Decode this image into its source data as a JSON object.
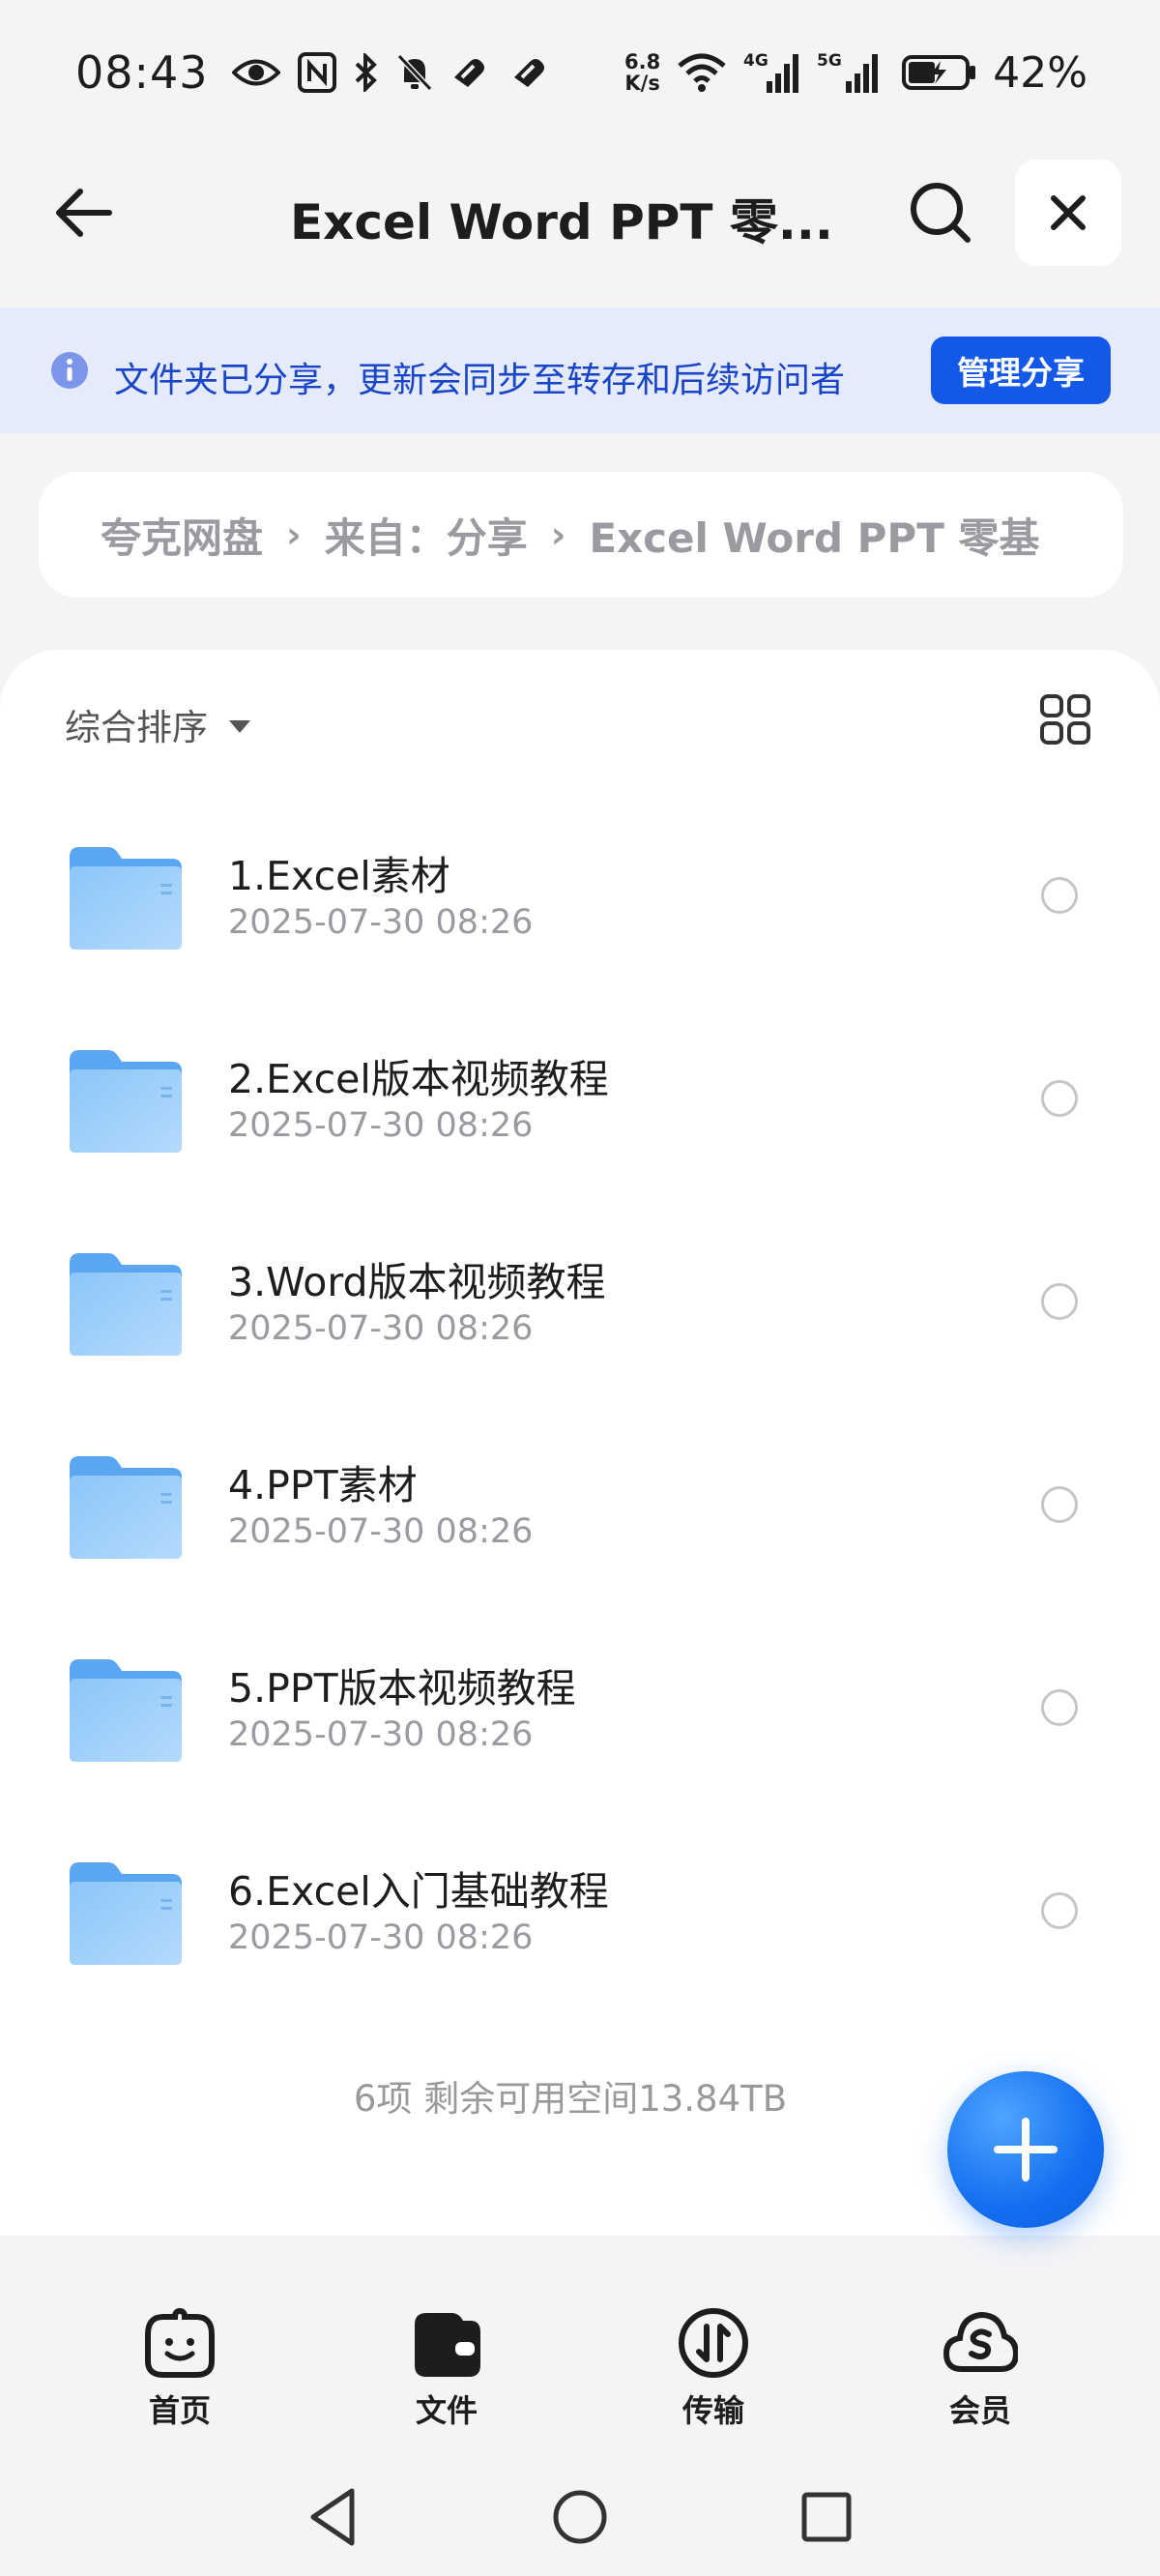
{
  "status_bar": {
    "time": "08:43",
    "net_rate_value": "6.8",
    "net_rate_unit": "K/s",
    "battery_percent": "42%",
    "left_icons": [
      "eye-icon",
      "nfc-icon",
      "bluetooth-icon",
      "mute-icon",
      "heart-icon",
      "heart-icon"
    ],
    "right_icons": [
      "wifi-icon",
      "signal-4g-icon",
      "signal-5g-icon",
      "battery-charging-icon"
    ]
  },
  "header": {
    "title": "Excel Word PPT 零...",
    "back_icon": "back-arrow-icon",
    "search_icon": "search-icon",
    "close_icon": "close-icon"
  },
  "banner": {
    "text": "文件夹已分享，更新会同步至转存和后续访问者",
    "button_label": "管理分享",
    "icon": "info-icon",
    "color": "#1946c8",
    "button_color": "#1358e6"
  },
  "breadcrumb": {
    "items": [
      "夸克网盘",
      "来自：分享",
      "Excel Word PPT 零基"
    ],
    "separator": "›"
  },
  "toolbar": {
    "sort_label": "综合排序",
    "view_icon": "grid-view-icon"
  },
  "files": [
    {
      "name": "1.Excel素材",
      "date": "2025-07-30 08:26"
    },
    {
      "name": "2.Excel版本视频教程",
      "date": "2025-07-30 08:26"
    },
    {
      "name": "3.Word版本视频教程",
      "date": "2025-07-30 08:26"
    },
    {
      "name": "4.PPT素材",
      "date": "2025-07-30 08:26"
    },
    {
      "name": "5.PPT版本视频教程",
      "date": "2025-07-30 08:26"
    },
    {
      "name": "6.Excel入门基础教程",
      "date": "2025-07-30 08:26"
    }
  ],
  "summary": "6项 剩余可用空间13.84TB",
  "fab_icon": "plus-icon",
  "tabs": [
    {
      "label": "首页",
      "icon": "home-smile-icon"
    },
    {
      "label": "文件",
      "icon": "folder-wallet-icon"
    },
    {
      "label": "传输",
      "icon": "transfer-icon"
    },
    {
      "label": "会员",
      "icon": "cloud-member-icon"
    }
  ],
  "system_nav": [
    "back-triangle-icon",
    "home-circle-icon",
    "recents-square-icon"
  ]
}
